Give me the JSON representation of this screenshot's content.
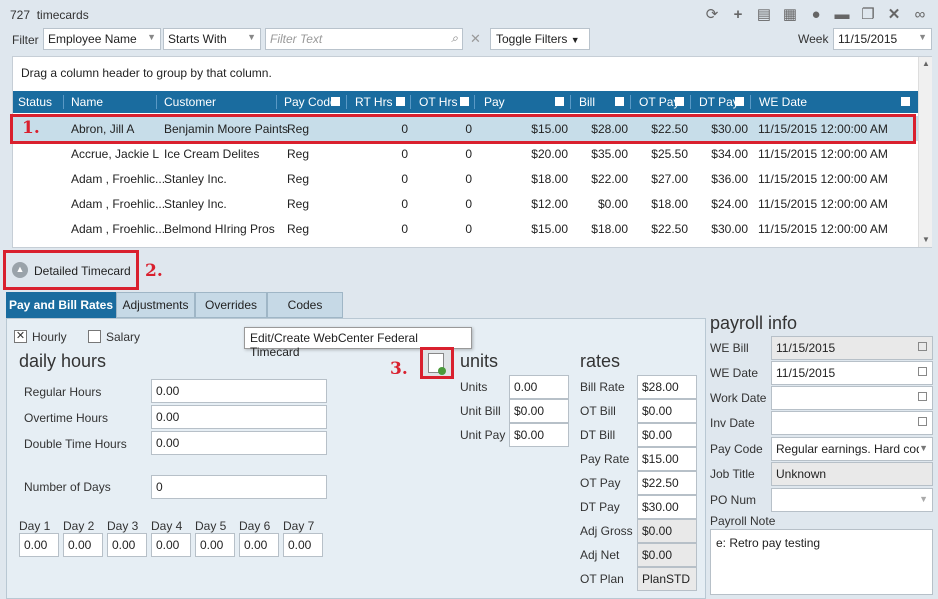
{
  "header": {
    "count": "727",
    "entity": "timecards",
    "icons": [
      "refresh-icon",
      "add-icon",
      "document-icon",
      "building-icon",
      "person-icon",
      "folder-icon",
      "copy-icon",
      "close-icon",
      "link-icon"
    ]
  },
  "filter": {
    "label": "Filter",
    "field": "Employee Name",
    "operator": "Starts With",
    "text_placeholder": "Filter Text",
    "toggle_label": "Toggle Filters",
    "week_label": "Week",
    "week_value": "11/15/2015"
  },
  "grid": {
    "group_hint": "Drag a column header to group by that column.",
    "columns": [
      "Status",
      "Name",
      "Customer",
      "Pay Code",
      "RT Hrs",
      "OT Hrs",
      "Pay",
      "Bill",
      "OT Pay",
      "DT Pay",
      "WE Date"
    ],
    "rows": [
      {
        "name": "Abron, Jill A",
        "customer": "Benjamin Moore Paints",
        "paycode": "Reg",
        "rt": "0",
        "ot": "0",
        "pay": "$15.00",
        "bill": "$28.00",
        "otpay": "$22.50",
        "dtpay": "$30.00",
        "wedate": "11/15/2015 12:00:00 AM"
      },
      {
        "name": "Accrue, Jackie L",
        "customer": "Ice Cream Delites",
        "paycode": "Reg",
        "rt": "0",
        "ot": "0",
        "pay": "$20.00",
        "bill": "$35.00",
        "otpay": "$25.50",
        "dtpay": "$34.00",
        "wedate": "11/15/2015 12:00:00 AM"
      },
      {
        "name": "Adam , Froehlic...",
        "customer": "Stanley Inc.",
        "paycode": "Reg",
        "rt": "0",
        "ot": "0",
        "pay": "$18.00",
        "bill": "$22.00",
        "otpay": "$27.00",
        "dtpay": "$36.00",
        "wedate": "11/15/2015 12:00:00 AM"
      },
      {
        "name": "Adam , Froehlic...",
        "customer": "Stanley Inc.",
        "paycode": "Reg",
        "rt": "0",
        "ot": "0",
        "pay": "$12.00",
        "bill": "$0.00",
        "otpay": "$18.00",
        "dtpay": "$24.00",
        "wedate": "11/15/2015 12:00:00 AM"
      },
      {
        "name": "Adam , Froehlic...",
        "customer": "Belmond HIring Pros",
        "paycode": "Reg",
        "rt": "0",
        "ot": "0",
        "pay": "$15.00",
        "bill": "$18.00",
        "otpay": "$22.50",
        "dtpay": "$30.00",
        "wedate": "11/15/2015 12:00:00 AM"
      }
    ]
  },
  "annotations": {
    "m1": "1.",
    "m2": "2.",
    "m3": "3."
  },
  "detail_toggle": "Detailed Timecard",
  "tabs": [
    "Pay and Bill Rates",
    "Adjustments",
    "Overrides",
    "Codes"
  ],
  "rates_panel": {
    "hourly_label": "Hourly",
    "salary_label": "Salary",
    "tooltip": "Edit/Create WebCenter Federal Timecard",
    "daily_hours_title": "daily hours",
    "regular_label": "Regular Hours",
    "regular_value": "0.00",
    "overtime_label": "Overtime Hours",
    "overtime_value": "0.00",
    "double_label": "Double Time Hours",
    "double_value": "0.00",
    "days_label": "Number of Days",
    "days_value": "0",
    "day_labels": [
      "Day 1",
      "Day 2",
      "Day 3",
      "Day 4",
      "Day 5",
      "Day 6",
      "Day 7"
    ],
    "day_values": [
      "0.00",
      "0.00",
      "0.00",
      "0.00",
      "0.00",
      "0.00",
      "0.00"
    ],
    "units_title": "units",
    "units_label": "Units",
    "units_value": "0.00",
    "unit_bill_label": "Unit Bill",
    "unit_bill_value": "$0.00",
    "unit_pay_label": "Unit Pay",
    "unit_pay_value": "$0.00",
    "rates_title": "rates",
    "rates": [
      {
        "label": "Bill Rate",
        "value": "$28.00"
      },
      {
        "label": "OT Bill",
        "value": "$0.00"
      },
      {
        "label": "DT Bill",
        "value": "$0.00"
      },
      {
        "label": "Pay Rate",
        "value": "$15.00"
      },
      {
        "label": "OT Pay",
        "value": "$22.50"
      },
      {
        "label": "DT Pay",
        "value": "$30.00"
      },
      {
        "label": "Adj Gross",
        "value": "$0.00"
      },
      {
        "label": "Adj Net",
        "value": "$0.00"
      },
      {
        "label": "OT Plan",
        "value": "PlanSTD"
      }
    ]
  },
  "payroll": {
    "title": "payroll info",
    "we_bill_label": "WE Bill",
    "we_bill_value": "11/15/2015",
    "we_date_label": "WE Date",
    "we_date_value": "11/15/2015",
    "work_date_label": "Work Date",
    "work_date_value": "",
    "inv_date_label": "Inv Date",
    "inv_date_value": "",
    "pay_code_label": "Pay Code",
    "pay_code_value": "Regular earnings.  Hard cod",
    "job_title_label": "Job Title",
    "job_title_value": "Unknown",
    "po_num_label": "PO Num",
    "po_num_value": "",
    "note_label": "Payroll Note",
    "note_value": "e: Retro pay testing"
  },
  "colors": {
    "accent": "#1a6c9f",
    "highlight": "#d9202e",
    "selected_row": "#c7dde9"
  }
}
